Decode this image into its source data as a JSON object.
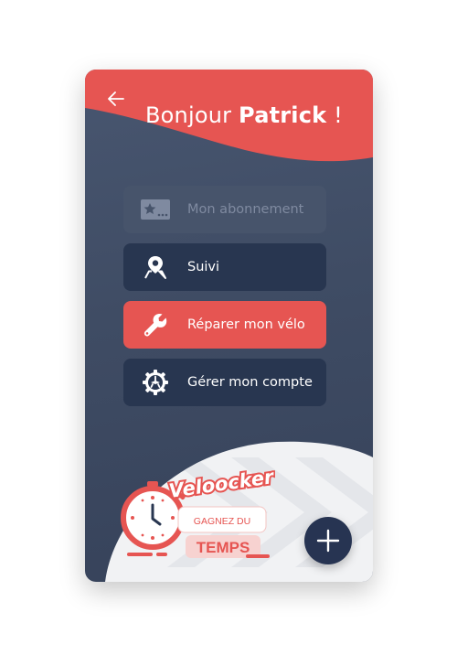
{
  "header": {
    "greeting_prefix": "Bonjour",
    "user_name": "Patrick",
    "greeting_suffix": "!",
    "back_icon": "arrow-left-icon"
  },
  "menu": [
    {
      "label": "Mon abonnement",
      "icon": "membership-card-icon",
      "state": "disabled"
    },
    {
      "label": "Suivi",
      "icon": "map-pin-icon",
      "state": "normal"
    },
    {
      "label": "Réparer mon vélo",
      "icon": "wrench-icon",
      "state": "active"
    },
    {
      "label": "Gérer mon compte",
      "icon": "gear-icon",
      "state": "normal"
    }
  ],
  "brand": {
    "name": "Veloocker",
    "tagline_top": "GAGNEZ DU",
    "tagline_bottom": "TEMPS",
    "icon": "clock-icon"
  },
  "fab": {
    "icon": "plus-icon"
  },
  "colors": {
    "accent": "#e65552",
    "card_dark": "#3f4c64",
    "button_dark": "#283650",
    "button_disabled": "#47546b",
    "fab": "#273452"
  }
}
